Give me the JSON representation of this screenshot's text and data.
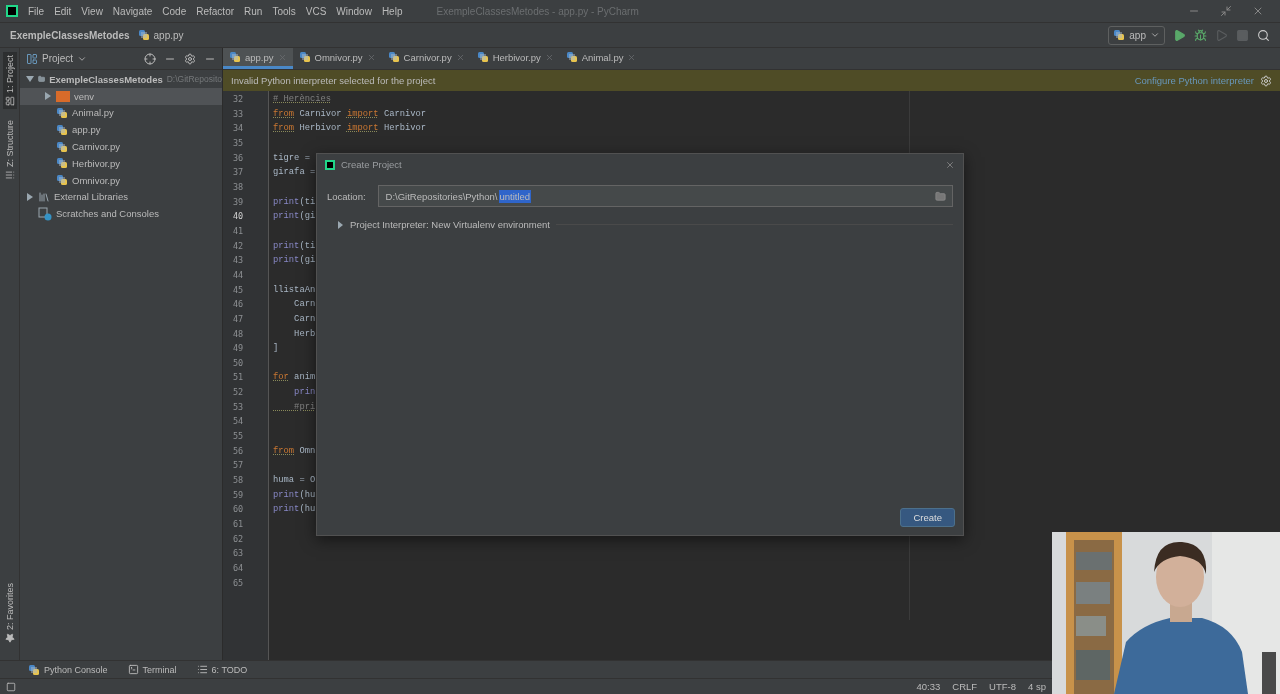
{
  "window": {
    "title": "ExempleClassesMetodes - app.py - PyCharm"
  },
  "menu": [
    "File",
    "Edit",
    "View",
    "Navigate",
    "Code",
    "Refactor",
    "Run",
    "Tools",
    "VCS",
    "Window",
    "Help"
  ],
  "breadcrumb": [
    {
      "label": "ExempleClassesMetodes",
      "kind": "project"
    },
    {
      "label": "app.py",
      "kind": "file"
    }
  ],
  "run_config": {
    "label": "app"
  },
  "toolbar": [
    {
      "kind": "run",
      "disabled": false
    },
    {
      "kind": "debug",
      "disabled": false
    },
    {
      "kind": "coverage",
      "disabled": true
    },
    {
      "kind": "stop",
      "disabled": true
    },
    {
      "kind": "search",
      "disabled": false
    }
  ],
  "side_stripe": [
    {
      "label": "1: Project",
      "selected": true,
      "kind": "project"
    },
    {
      "label": "Z: Structure",
      "selected": false,
      "kind": "structure"
    },
    {
      "label": "2: Favorites",
      "selected": false,
      "kind": "favorites"
    }
  ],
  "project_panel": {
    "title": "Project",
    "tree": [
      {
        "label": "ExempleClassesMetodes",
        "path": "D:\\GitReposito",
        "kind": "folder",
        "expanded": true,
        "children": [
          {
            "label": "venv",
            "kind": "venv",
            "expanded": false,
            "selected": true
          },
          {
            "label": "Animal.py",
            "kind": "python",
            "selected": false
          },
          {
            "label": "app.py",
            "kind": "python",
            "selected": false
          },
          {
            "label": "Carnivor.py",
            "kind": "python",
            "selected": false
          },
          {
            "label": "Herbivor.py",
            "kind": "python",
            "selected": false
          },
          {
            "label": "Omnivor.py",
            "kind": "python",
            "selected": false
          }
        ]
      },
      {
        "label": "External Libraries",
        "kind": "library",
        "expanded": false
      },
      {
        "label": "Scratches and Consoles",
        "kind": "scratch"
      }
    ]
  },
  "tabs": [
    {
      "label": "app.py",
      "selected": true
    },
    {
      "label": "Omnivor.py",
      "selected": false
    },
    {
      "label": "Carnivor.py",
      "selected": false
    },
    {
      "label": "Herbivor.py",
      "selected": false
    },
    {
      "label": "Animal.py",
      "selected": false
    }
  ],
  "banner": {
    "message": "Invalid Python interpreter selected for the project",
    "link": "Configure Python interpreter"
  },
  "code_lines": [
    {
      "number": "32",
      "current": false,
      "tokens": [
        {
          "text": "# Herències",
          "kind": "comment"
        }
      ]
    },
    {
      "number": "33",
      "current": false,
      "tokens": [
        {
          "text": "from",
          "kind": "keyword"
        },
        {
          "text": " Carnivor ",
          "kind": "name"
        },
        {
          "text": "import",
          "kind": "keyword"
        },
        {
          "text": " Carnivor",
          "kind": "name"
        }
      ]
    },
    {
      "number": "34",
      "current": false,
      "tokens": [
        {
          "text": "from",
          "kind": "keyword"
        },
        {
          "text": " Herbivor ",
          "kind": "name"
        },
        {
          "text": "import",
          "kind": "keyword"
        },
        {
          "text": " Herbivor",
          "kind": "name"
        }
      ]
    },
    {
      "number": "35",
      "current": false
    },
    {
      "number": "36",
      "current": false,
      "tokens": [
        {
          "text": "tigre =",
          "kind": "name"
        }
      ]
    },
    {
      "number": "37",
      "current": false,
      "tokens": [
        {
          "text": "girafa =",
          "kind": "name"
        }
      ]
    },
    {
      "number": "38",
      "current": false
    },
    {
      "number": "39",
      "current": false,
      "tokens": [
        {
          "text": "print",
          "kind": "builtin"
        },
        {
          "text": "(ti",
          "kind": "name"
        }
      ]
    },
    {
      "number": "40",
      "current": true,
      "tokens": [
        {
          "text": "print",
          "kind": "builtin"
        },
        {
          "text": "(gi",
          "kind": "name"
        }
      ]
    },
    {
      "number": "41",
      "current": false
    },
    {
      "number": "42",
      "current": false,
      "tokens": [
        {
          "text": "print",
          "kind": "builtin"
        },
        {
          "text": "(ti",
          "kind": "name"
        }
      ]
    },
    {
      "number": "43",
      "current": false,
      "tokens": [
        {
          "text": "print",
          "kind": "builtin"
        },
        {
          "text": "(gi",
          "kind": "name"
        }
      ]
    },
    {
      "number": "44",
      "current": false
    },
    {
      "number": "45",
      "current": false,
      "tokens": [
        {
          "text": "llistaAn",
          "kind": "name"
        }
      ]
    },
    {
      "number": "46",
      "current": false,
      "tokens": [
        {
          "text": "    Carn",
          "kind": "name"
        }
      ]
    },
    {
      "number": "47",
      "current": false,
      "tokens": [
        {
          "text": "    Carn",
          "kind": "name"
        }
      ]
    },
    {
      "number": "48",
      "current": false,
      "tokens": [
        {
          "text": "    Herb",
          "kind": "name"
        }
      ]
    },
    {
      "number": "49",
      "current": false,
      "tokens": [
        {
          "text": "]",
          "kind": "name"
        }
      ]
    },
    {
      "number": "50",
      "current": false
    },
    {
      "number": "51",
      "current": false,
      "tokens": [
        {
          "text": "for",
          "kind": "keyword"
        },
        {
          "text": " anim",
          "kind": "name"
        }
      ]
    },
    {
      "number": "52",
      "current": false,
      "tokens": [
        {
          "text": "    prin",
          "kind": "builtin"
        }
      ]
    },
    {
      "number": "53",
      "current": false,
      "tokens": [
        {
          "text": "    #pri",
          "kind": "comment"
        }
      ]
    },
    {
      "number": "54",
      "current": false
    },
    {
      "number": "55",
      "current": false
    },
    {
      "number": "56",
      "current": false,
      "tokens": [
        {
          "text": "from",
          "kind": "keyword"
        },
        {
          "text": " Omn",
          "kind": "name"
        }
      ]
    },
    {
      "number": "57",
      "current": false
    },
    {
      "number": "58",
      "current": false,
      "tokens": [
        {
          "text": "huma = O",
          "kind": "name"
        }
      ]
    },
    {
      "number": "59",
      "current": false,
      "tokens": [
        {
          "text": "print",
          "kind": "builtin"
        },
        {
          "text": "(hu",
          "kind": "name"
        }
      ]
    },
    {
      "number": "60",
      "current": false,
      "tokens": [
        {
          "text": "print",
          "kind": "builtin"
        },
        {
          "text": "(hu",
          "kind": "name"
        }
      ]
    },
    {
      "number": "61",
      "current": false
    },
    {
      "number": "62",
      "current": false
    },
    {
      "number": "63",
      "current": false
    },
    {
      "number": "64",
      "current": false
    },
    {
      "number": "65",
      "current": false
    }
  ],
  "dialog": {
    "title": "Create Project",
    "location_label": "Location:",
    "location_parts": [
      {
        "text": "D:\\GitRepositories\\Python\\",
        "selected": false
      },
      {
        "text": "untitled",
        "selected": true
      }
    ],
    "interpreter": {
      "label": "Project Interpreter: New Virtualenv environment",
      "expanded": false
    },
    "button": "Create"
  },
  "tool_windows": [
    {
      "label": "Python Console",
      "kind": "python"
    },
    {
      "label": "Terminal",
      "kind": "terminal"
    },
    {
      "label": "6: TODO",
      "kind": "todo"
    }
  ],
  "status_bar": [
    "40:33",
    "CRLF",
    "UTF-8",
    "4 sp"
  ],
  "webcam": {
    "kind": "picture"
  }
}
